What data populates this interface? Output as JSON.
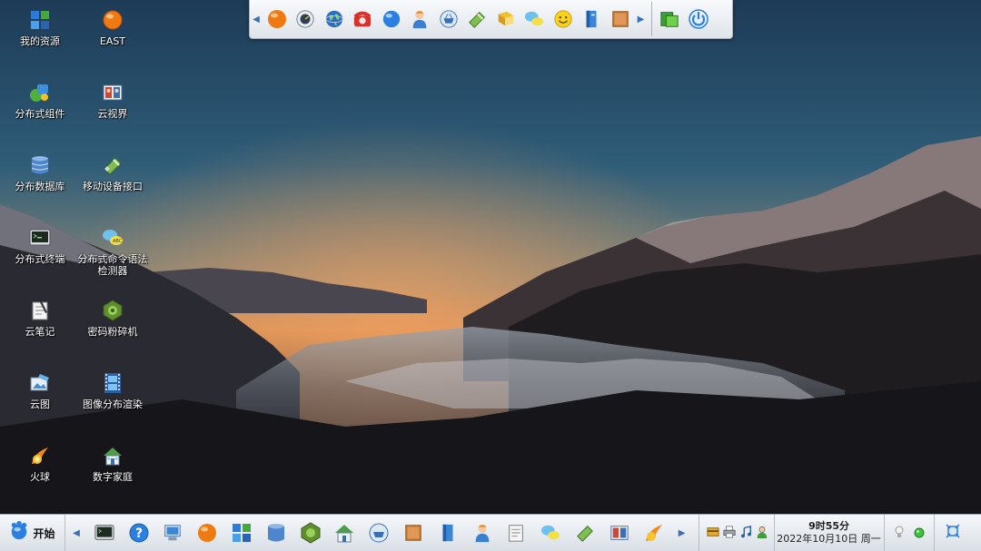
{
  "desktop": {
    "icons": [
      {
        "label": "我的资源",
        "icon": "puzzle-icon"
      },
      {
        "label": "EAST",
        "icon": "orange-globe-icon"
      },
      {
        "label": "分布式组件",
        "icon": "components-icon"
      },
      {
        "label": "云视界",
        "icon": "photo-frame-icon"
      },
      {
        "label": "分布数据库",
        "icon": "database-icon"
      },
      {
        "label": "移动设备接口",
        "icon": "usb-device-icon"
      },
      {
        "label": "分布式终端",
        "icon": "terminal-icon"
      },
      {
        "label": "分布式命令语法检测器",
        "icon": "chat-bubbles-icon"
      },
      {
        "label": "云笔记",
        "icon": "notepad-icon"
      },
      {
        "label": "密码粉碎机",
        "icon": "shredder-icon"
      },
      {
        "label": "云图",
        "icon": "cloud-picture-icon"
      },
      {
        "label": "图像分布渲染",
        "icon": "film-strip-icon"
      },
      {
        "label": "火球",
        "icon": "fireball-icon"
      },
      {
        "label": "数字家庭",
        "icon": "house-icon"
      }
    ]
  },
  "top_bar": {
    "icons": [
      "orange-globe-icon",
      "gauge-icon",
      "world-icon",
      "telephone-icon",
      "blue-ball-icon",
      "person-icon",
      "basket-icon",
      "usb-device-icon",
      "book-icon",
      "chat-bubbles-icon",
      "smiley-icon",
      "notebook-icon",
      "box-icon"
    ],
    "action_icons": [
      "window-switch-icon",
      "power-icon"
    ]
  },
  "taskbar": {
    "start_label": "开始",
    "icons": [
      "terminal-icon",
      "help-icon",
      "desktop-pc-icon",
      "orange-globe-icon",
      "puzzle-icon",
      "database-icon",
      "shredder-icon",
      "house-icon",
      "basket-icon",
      "box-icon",
      "notebook-icon",
      "person-icon",
      "notepad-icon",
      "chat-bubbles-icon",
      "usb-device-icon",
      "photo-frame-icon",
      "fireball-icon"
    ],
    "tray_icons": [
      "card-icon",
      "printer-icon",
      "music-note-icon",
      "user-icon"
    ],
    "clock": {
      "time": "9时55分",
      "date": "2022年10月10日 周一"
    },
    "status_icons": [
      "lightbulb-icon",
      "green-dot-icon"
    ]
  },
  "colors": {
    "accent": "#3a6fb3",
    "taskbar_top": "#f6f8fb",
    "taskbar_bottom": "#d9dfe6"
  }
}
